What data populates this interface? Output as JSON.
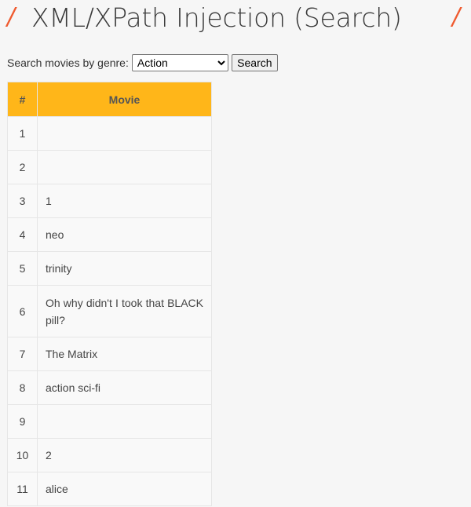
{
  "page": {
    "title": "XML/XPath Injection (Search)",
    "title_slash": "/"
  },
  "search": {
    "label": "Search movies by genre:",
    "selected_genre": "Action",
    "button_label": "Search"
  },
  "table": {
    "headers": [
      "#",
      "Movie"
    ],
    "rows": [
      {
        "num": "1",
        "movie": ""
      },
      {
        "num": "2",
        "movie": ""
      },
      {
        "num": "3",
        "movie": "1"
      },
      {
        "num": "4",
        "movie": "neo"
      },
      {
        "num": "5",
        "movie": "trinity"
      },
      {
        "num": "6",
        "movie": "Oh why didn't I took that BLACK pill?"
      },
      {
        "num": "7",
        "movie": "The Matrix"
      },
      {
        "num": "8",
        "movie": "action sci-fi"
      },
      {
        "num": "9",
        "movie": ""
      },
      {
        "num": "10",
        "movie": "2"
      },
      {
        "num": "11",
        "movie": "alice"
      }
    ]
  },
  "colors": {
    "header_bg": "#ffb619",
    "accent_slash": "#ef5a2f",
    "page_bg": "#f6f6f6"
  }
}
